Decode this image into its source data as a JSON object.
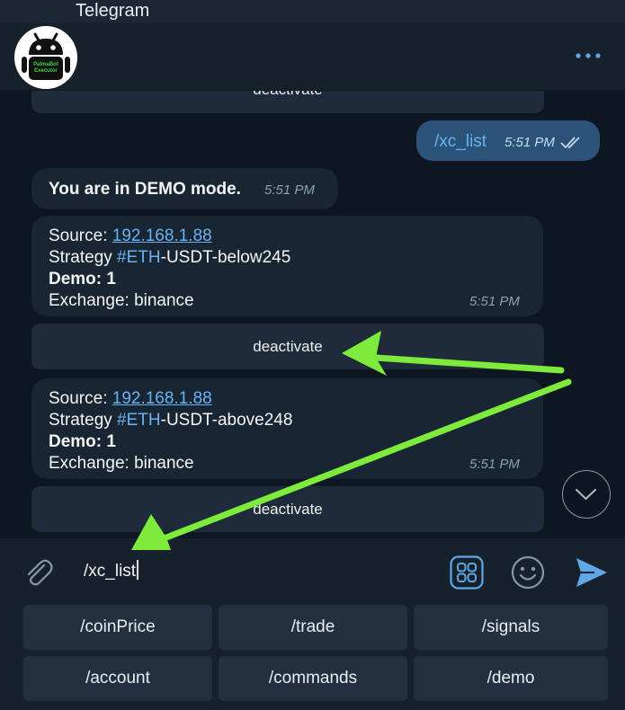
{
  "status_bar": {
    "app_name": "Telegram"
  },
  "header": {
    "avatar_label_line1": "PalmaBot",
    "avatar_label_line2": "Executor"
  },
  "messages": {
    "prev_keyboard_button": "deactivate",
    "outgoing": {
      "text": "/xc_list",
      "time": "5:51 PM"
    },
    "demo_notice": {
      "text": "You are in DEMO mode.",
      "time": "5:51 PM"
    },
    "strategy1": {
      "source_label": "Source: ",
      "source_ip": "192.168.1.88",
      "strategy_label": "Strategy ",
      "strategy_tag": "#ETH",
      "strategy_rest": "-USDT-below245",
      "demo": "Demo: 1",
      "exchange": "Exchange: binance",
      "time": "5:51 PM",
      "button": "deactivate"
    },
    "strategy2": {
      "source_label": "Source: ",
      "source_ip": "192.168.1.88",
      "strategy_label": "Strategy ",
      "strategy_tag": "#ETH",
      "strategy_rest": "-USDT-above248",
      "demo": "Demo: 1",
      "exchange": "Exchange: binance",
      "time": "5:51 PM",
      "button": "deactivate"
    }
  },
  "input": {
    "value": "/xc_list"
  },
  "reply_keyboard": [
    [
      "/coinPrice",
      "/trade",
      "/signals"
    ],
    [
      "/account",
      "/commands",
      "/demo"
    ]
  ],
  "colors": {
    "accent": "#6ab3f3",
    "outgoing_bubble": "#2b5278",
    "incoming_bubble": "#182533",
    "chat_background": "#0e1621",
    "annotation_arrow": "#7dea3c"
  }
}
